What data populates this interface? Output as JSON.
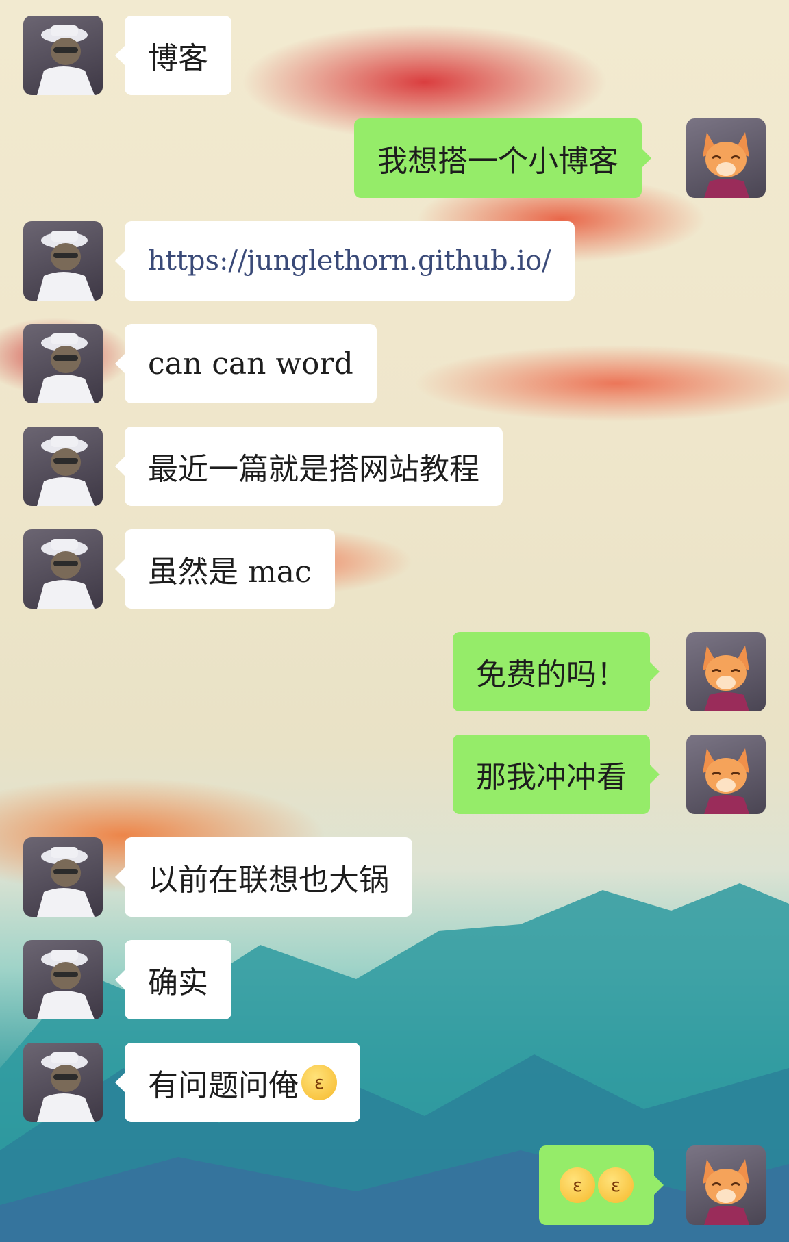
{
  "conversation": {
    "messages": [
      {
        "side": "in",
        "text": "博客"
      },
      {
        "side": "out",
        "text": "我想搭一个小博客"
      },
      {
        "side": "in",
        "text": "https://junglethorn.github.io/"
      },
      {
        "side": "in",
        "text": "can can word"
      },
      {
        "side": "in",
        "text": "最近一篇就是搭网站教程"
      },
      {
        "side": "in",
        "text": "虽然是 mac"
      },
      {
        "side": "out",
        "text": "免费的吗！"
      },
      {
        "side": "out",
        "text": "那我冲冲看"
      },
      {
        "side": "in",
        "text": "以前在联想也大锅"
      },
      {
        "side": "in",
        "text": "确实"
      },
      {
        "side": "in",
        "text": "有问题问俺",
        "emoji": "kissing-face-emoji"
      },
      {
        "side": "out",
        "text": "",
        "emoji": "kissing-face-emoji",
        "emoji_count": 2
      }
    ]
  },
  "colors": {
    "outgoing_bubble": "#95ec69",
    "incoming_bubble": "#ffffff",
    "text": "#1d1d1d"
  }
}
